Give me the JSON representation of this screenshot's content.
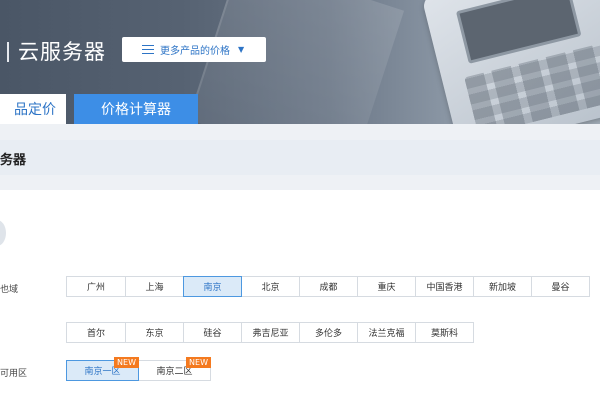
{
  "banner": {
    "title": "云服务器",
    "more_button": "更多产品的价格"
  },
  "tabs": [
    {
      "label": "品定价",
      "active": true
    },
    {
      "label": "价格计算器",
      "active": false
    }
  ],
  "section": {
    "title": "务器"
  },
  "region": {
    "label": "也域",
    "row1": [
      "广州",
      "上海",
      "南京",
      "北京",
      "成都",
      "重庆",
      "中国香港",
      "新加坡",
      "曼谷"
    ],
    "row2": [
      "首尔",
      "东京",
      "硅谷",
      "弗吉尼亚",
      "多伦多",
      "法兰克福",
      "莫斯科"
    ],
    "selected": "南京"
  },
  "zone": {
    "label": "可用区",
    "options": [
      {
        "label": "南京一区",
        "badge": "NEW",
        "selected": true
      },
      {
        "label": "南京二区",
        "badge": "NEW",
        "selected": false
      }
    ]
  },
  "colors": {
    "accent": "#2d74c6",
    "tab_active_bg": "#3d8ee6",
    "badge": "#f47a1f"
  }
}
